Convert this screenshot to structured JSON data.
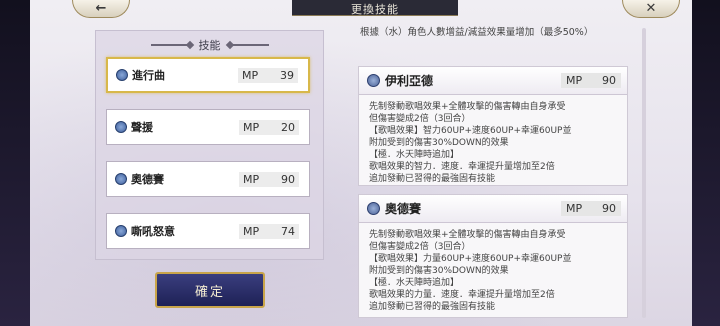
{
  "header": {
    "title": "更換技能"
  },
  "nav": {
    "back_icon": "←",
    "close_icon": "✕"
  },
  "skills": {
    "title": "技能",
    "items": [
      {
        "name": "進行曲",
        "mp_label": "MP",
        "mp": "39",
        "selected": true
      },
      {
        "name": "聲援",
        "mp_label": "MP",
        "mp": "20"
      },
      {
        "name": "奧德賽",
        "mp_label": "MP",
        "mp": "90"
      },
      {
        "name": "嘶吼怒意",
        "mp_label": "MP",
        "mp": "74"
      }
    ],
    "confirm_label": "確定"
  },
  "details": {
    "top_text": "根據（水）角色人數增益/減益效果量增加（最多50%）",
    "cards": [
      {
        "name": "伊利亞德",
        "mp_label": "MP",
        "mp": "90",
        "lines": [
          "先制發動歌唱效果+全體攻擊的傷害轉由自身承受",
          "但傷害變成2倍（3回合）",
          "【歌唱效果】智力60UP+速度60UP+幸運60UP並",
          "附加受到的傷害30%DOWN的效果",
          "【極．水天陣時追加】",
          "歌唱效果的智力．速度．幸運提升量增加至2倍",
          "追加發動已習得的最強固有技能"
        ]
      },
      {
        "name": "奧德賽",
        "mp_label": "MP",
        "mp": "90",
        "lines": [
          "先制發動歌唱效果+全體攻擊的傷害轉由自身承受",
          "但傷害變成2倍（3回合）",
          "【歌唱效果】力量60UP+速度60UP+幸運60UP並",
          "附加受到的傷害30%DOWN的效果",
          "【極．水天陣時追加】",
          "歌唱效果的力量．速度．幸運提升量增加至2倍",
          "追加發動已習得的最強固有技能"
        ]
      }
    ]
  }
}
